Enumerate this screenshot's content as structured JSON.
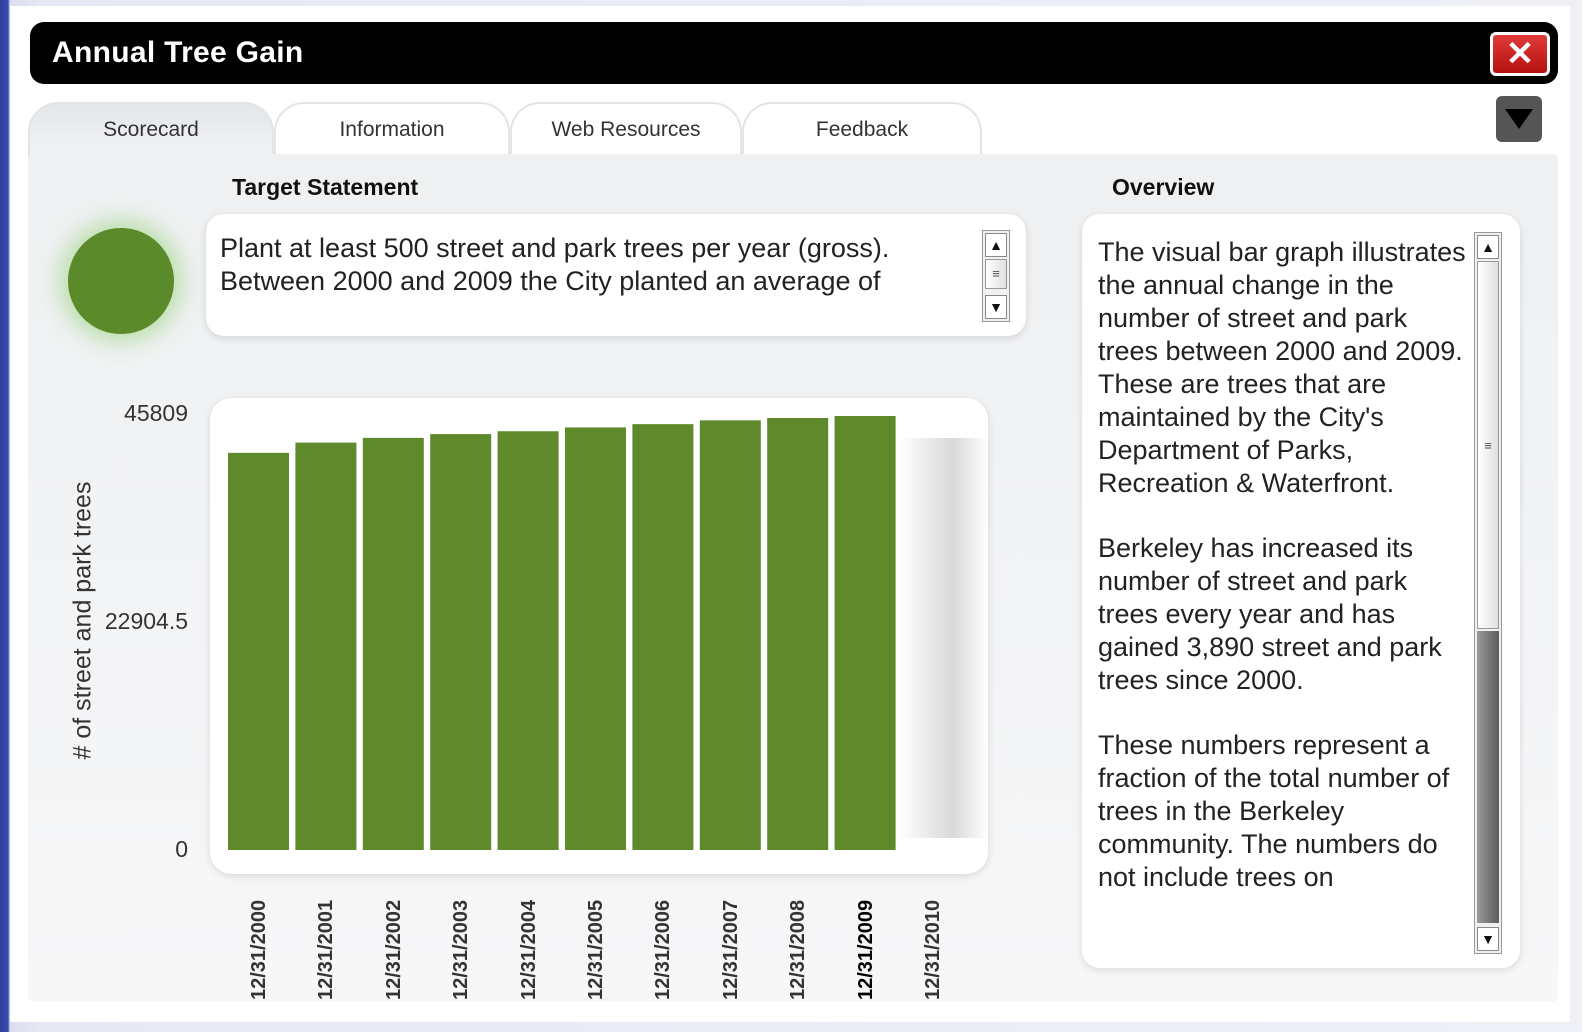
{
  "window": {
    "title": "Annual Tree Gain",
    "close_label": "✕"
  },
  "tabs": [
    {
      "label": "Scorecard",
      "active": true
    },
    {
      "label": "Information",
      "active": false
    },
    {
      "label": "Web Resources",
      "active": false
    },
    {
      "label": "Feedback",
      "active": false
    }
  ],
  "target": {
    "heading": "Target Statement",
    "text": "Plant at least 500 street and park trees per year (gross). Between 2000 and 2009 the City planted an average of",
    "status_color": "#5a8a2a"
  },
  "overview": {
    "heading": "Overview",
    "paragraphs": [
      "The visual bar graph illustrates the annual change in the number of street and park trees between 2000 and 2009. These are trees that are maintained by the City's Department of Parks, Recreation & Waterfront.",
      "Berkeley has increased its number of street and park trees every year and has gained 3,890 street and park trees since 2000.",
      "These numbers represent a fraction of the total number of trees in the Berkeley community.  The numbers do not include trees on"
    ]
  },
  "icons": {
    "close": "close-icon",
    "collapse": "triangle-down-icon",
    "scroll_up": "arrow-up-icon",
    "scroll_down": "arrow-down-icon",
    "scroll_grip": "grip-icon"
  },
  "chart_data": {
    "type": "bar",
    "title": "",
    "xlabel": "",
    "ylabel": "# of street and park trees",
    "ylim": [
      0,
      45809
    ],
    "ytick_labels": [
      "45809",
      "22904.5",
      "0"
    ],
    "categories": [
      "12/31/2000",
      "12/31/2001",
      "12/31/2002",
      "12/31/2003",
      "12/31/2004",
      "12/31/2005",
      "12/31/2006",
      "12/31/2007",
      "12/31/2008",
      "12/31/2009",
      "12/31/2010"
    ],
    "values": [
      41919,
      43000,
      43500,
      43900,
      44200,
      44600,
      44950,
      45350,
      45600,
      45809,
      null
    ],
    "bar_color": "#5e8a2c",
    "highlighted_category": "12/31/2009"
  }
}
